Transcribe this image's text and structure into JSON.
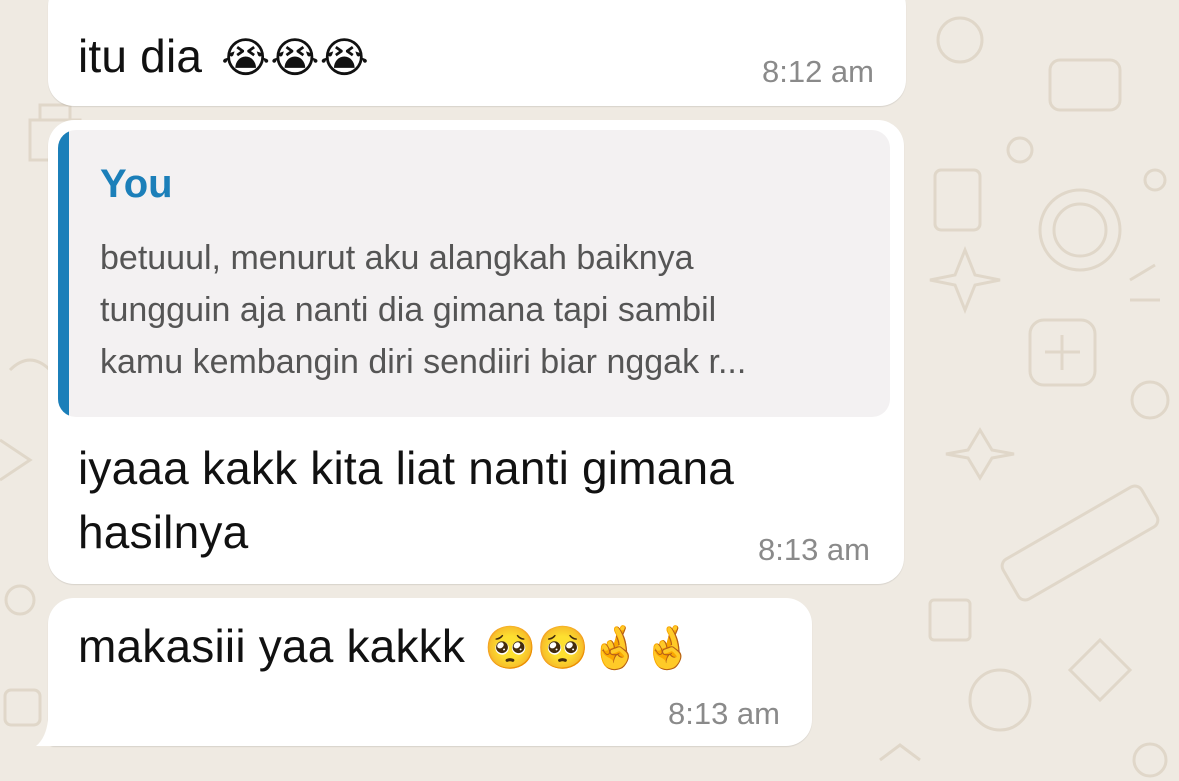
{
  "messages": [
    {
      "text": "itu dia",
      "emoji": "😭😭😭",
      "time": "8:12 am"
    },
    {
      "quote": {
        "author": "You",
        "lines": [
          "betuuul, menurut aku alangkah baiknya",
          "tungguin aja nanti dia gimana tapi sambil",
          "kamu kembangin diri sendiiri biar nggak r..."
        ]
      },
      "lines": [
        "iyaaa kakk kita liat nanti gimana",
        "hasilnya"
      ],
      "time": "8:13 am"
    },
    {
      "text": "makasiii yaa kakkk",
      "emoji": "🥺🥺🤞🤞",
      "time": "8:13 am"
    }
  ],
  "colors": {
    "wallpaper": "#efeae2",
    "bubble": "#ffffff",
    "quote_bar": "#1b7fb9",
    "quote_author": "#1b7fb9",
    "timestamp": "#8a8a8a"
  }
}
